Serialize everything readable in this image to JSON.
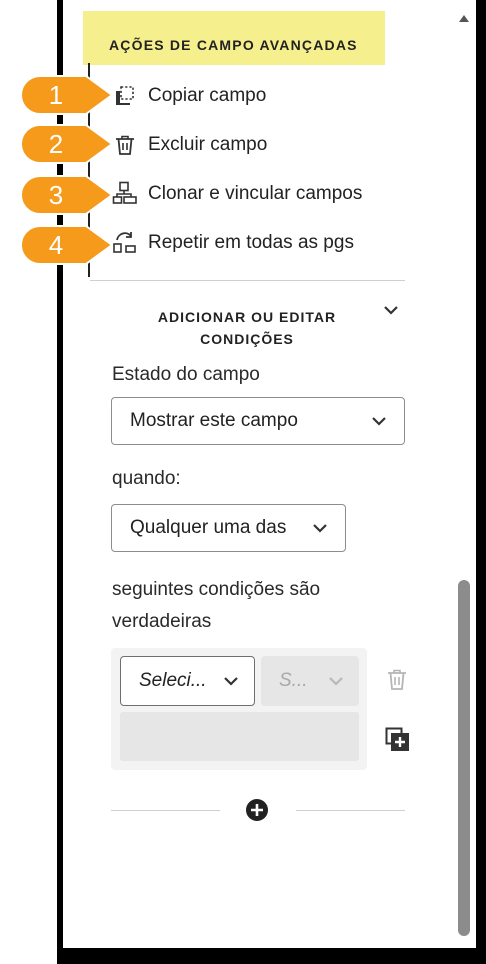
{
  "panel": {
    "advanced_header": "AÇÕES DE CAMPO AVANÇADAS",
    "actions": [
      {
        "number": "1",
        "label": "Copiar campo",
        "icon": "copy-field-icon"
      },
      {
        "number": "2",
        "label": "Excluir campo",
        "icon": "trash-icon"
      },
      {
        "number": "3",
        "label": "Clonar e vincular campos",
        "icon": "clone-link-icon"
      },
      {
        "number": "4",
        "label": "Repetir em todas as pgs",
        "icon": "repeat-pages-icon"
      }
    ],
    "conditions_title_line1": "ADICIONAR OU EDITAR",
    "conditions_title_line2": "CONDIÇÕES",
    "field_state_label": "Estado do campo",
    "field_state_value": "Mostrar este campo",
    "when_label": "quando:",
    "any_value": "Qualquer uma das",
    "conditions_text_line1": "seguintes condições são",
    "conditions_text_line2": "verdadeiras",
    "condition_select_value": "Selecionar...",
    "condition_select_display": "Seleci...",
    "condition_op_display": "S...",
    "callout_color": "#f59a1b",
    "header_color": "#f6ef8e"
  }
}
